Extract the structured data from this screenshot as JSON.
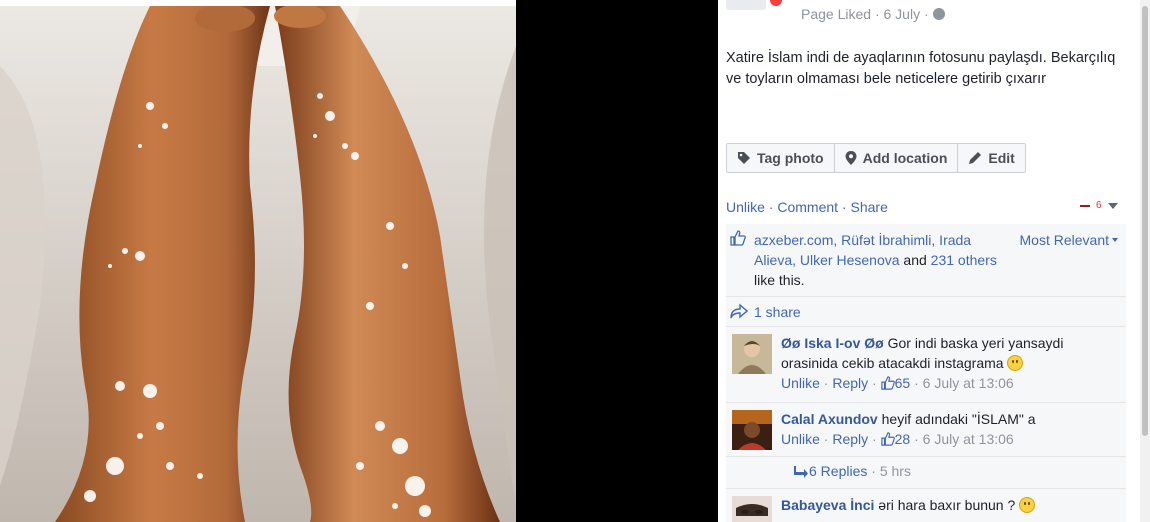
{
  "post": {
    "meta_text": "Page Liked · 6 July ·",
    "caption": "Xatire İslam indi de ayaqlarının fotosunu paylaşdı. Bekarçılıq ve toyların olmaması bele neticelere getirib çıxarır"
  },
  "action_bar": {
    "tag_photo": "Tag photo",
    "add_location": "Add location",
    "edit": "Edit"
  },
  "post_actions": {
    "unlike": "Unlike",
    "comment": "Comment",
    "share": "Share",
    "notif_count": "6"
  },
  "likes": {
    "names": "azxeber.com, Rüfət İbrahimli, Irada Alieva, Ulker Hesenova",
    "and_text": " and ",
    "others": "231 others",
    "suffix": " like this.",
    "sort_label": "Most Relevant"
  },
  "shares": {
    "label": "1 share"
  },
  "comments": [
    {
      "name": "Øø Iska I-ov Øø",
      "text": " Gor indi baska yeri yansaydi orasinida cekib atacakdi instagrama ",
      "unlike": "Unlike",
      "reply": "Reply",
      "likes": "65",
      "time": "6 July at 13:06"
    },
    {
      "name": "Calal Axundov",
      "text": " heyif adındaki \"İSLAM\" a",
      "unlike": "Unlike",
      "reply": "Reply",
      "likes": "28",
      "time": "6 July at 13:06"
    },
    {
      "name": "Babayeva İnci",
      "text": " əri hara baxır bunun ? "
    }
  ],
  "replies": {
    "label": "6 Replies",
    "sep": " · ",
    "time": "5 hrs"
  },
  "colors": {
    "link": "#4267b2",
    "name": "#365899",
    "meta": "#90949c",
    "panel_bg": "#f6f7f9"
  }
}
